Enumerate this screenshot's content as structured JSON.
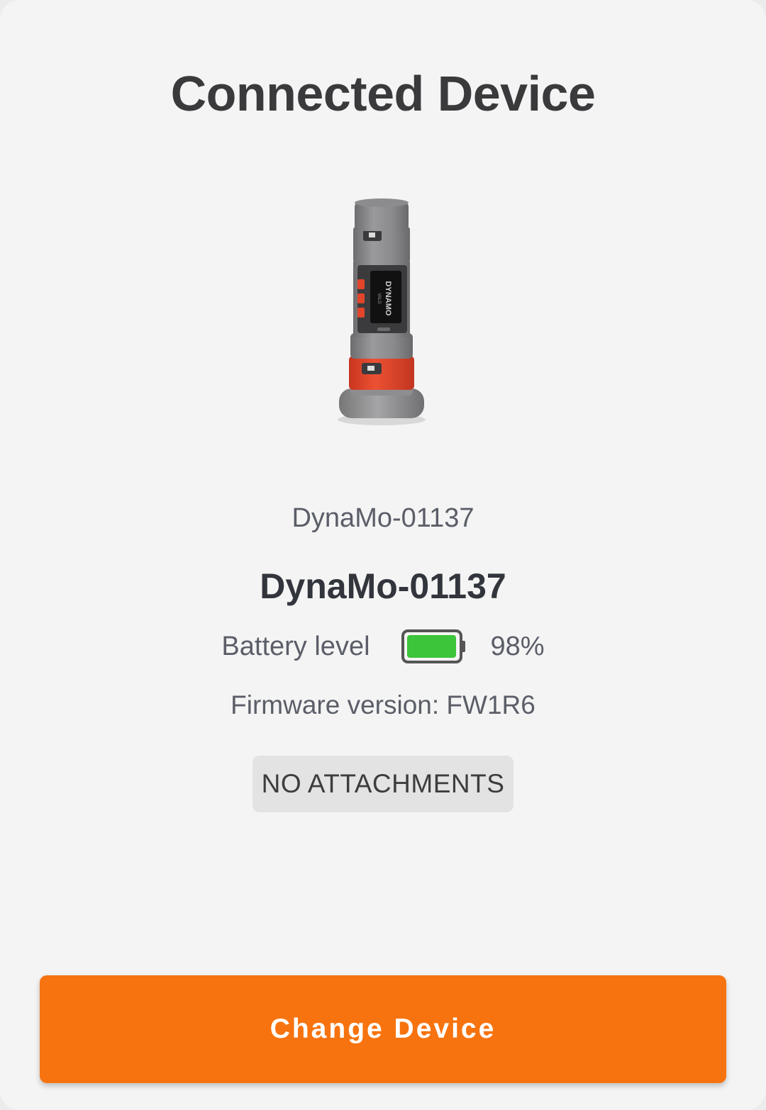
{
  "page": {
    "title": "Connected Device"
  },
  "device": {
    "image_label": "DYNAMO",
    "image_sublabel": "VALD",
    "subname": "DynaMo-01137",
    "name": "DynaMo-01137",
    "battery": {
      "label": "Battery level",
      "level_fraction": 0.98,
      "percent_text": "98%",
      "fill_color": "#3cc43a"
    },
    "firmware": "Firmware version: FW1R6",
    "attachments": "NO ATTACHMENTS"
  },
  "actions": {
    "change_device": "Change Device"
  },
  "colors": {
    "accent": "#f7730f",
    "device_orange": "#e2452a"
  }
}
